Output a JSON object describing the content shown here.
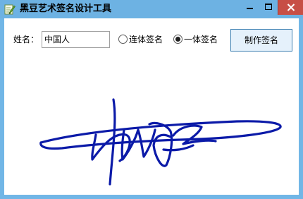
{
  "window": {
    "title": "黑豆艺术签名设计工具"
  },
  "form": {
    "name_label": "姓名：",
    "name_value": "中国人",
    "radio_options": [
      {
        "label": "连体签名",
        "checked": false
      },
      {
        "label": "一体签名",
        "checked": true
      }
    ],
    "make_button": "制作签名"
  },
  "signature": {
    "color": "#0b1aa8"
  }
}
